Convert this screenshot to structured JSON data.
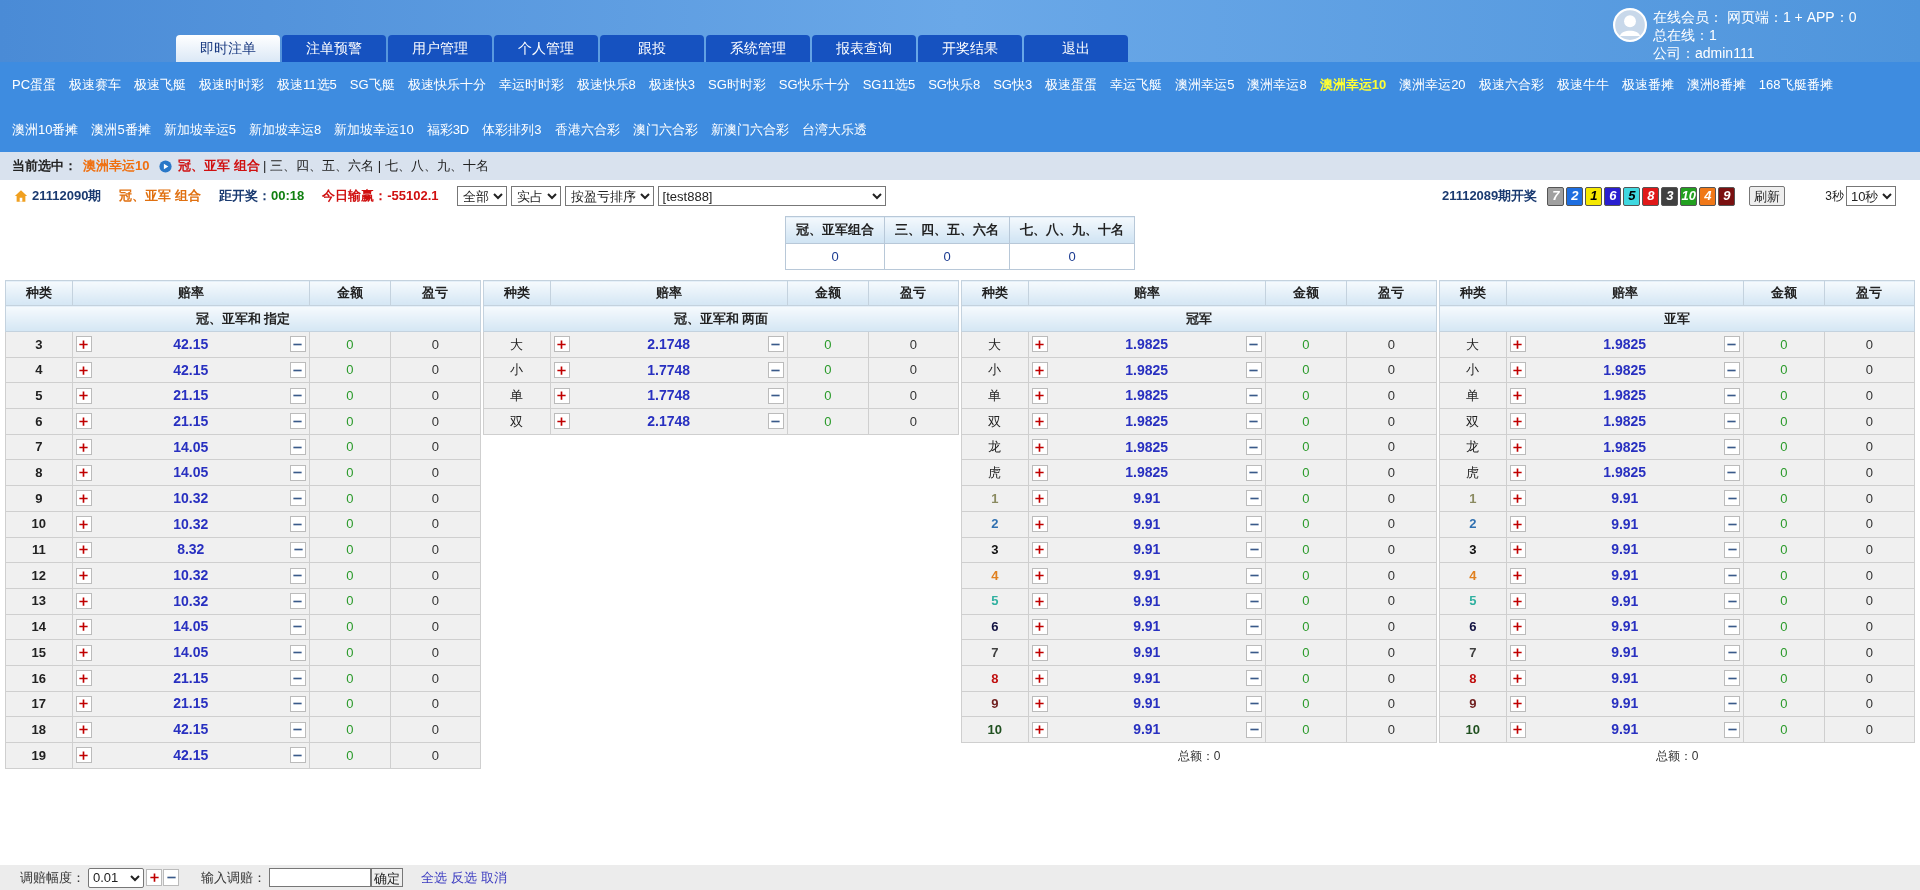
{
  "header": {
    "tabs": [
      {
        "label": "即时注单",
        "selected": true
      },
      {
        "label": "注单预警",
        "selected": false
      },
      {
        "label": "用户管理",
        "selected": false
      },
      {
        "label": "个人管理",
        "selected": false
      },
      {
        "label": "跟投",
        "selected": false
      },
      {
        "label": "系统管理",
        "selected": false
      },
      {
        "label": "报表查询",
        "selected": false
      },
      {
        "label": "开奖结果",
        "selected": false
      },
      {
        "label": "退出",
        "selected": false
      }
    ],
    "user_lines": [
      "在线会员： 网页端：1 + APP：0",
      "总在线：1",
      "公司：admin111"
    ]
  },
  "lottery_nav": [
    [
      {
        "label": "PC蛋蛋",
        "selected": false
      },
      {
        "label": "极速赛车",
        "selected": false
      },
      {
        "label": "极速飞艇",
        "selected": false
      },
      {
        "label": "极速时时彩",
        "selected": false
      },
      {
        "label": "极速11选5",
        "selected": false
      },
      {
        "label": "SG飞艇",
        "selected": false
      },
      {
        "label": "极速快乐十分",
        "selected": false
      },
      {
        "label": "幸运时时彩",
        "selected": false
      },
      {
        "label": "极速快乐8",
        "selected": false
      },
      {
        "label": "极速快3",
        "selected": false
      },
      {
        "label": "SG时时彩",
        "selected": false
      },
      {
        "label": "SG快乐十分",
        "selected": false
      },
      {
        "label": "SG11选5",
        "selected": false
      },
      {
        "label": "SG快乐8",
        "selected": false
      },
      {
        "label": "SG快3",
        "selected": false
      },
      {
        "label": "极速蛋蛋",
        "selected": false
      },
      {
        "label": "幸运飞艇",
        "selected": false
      },
      {
        "label": "澳洲幸运5",
        "selected": false
      },
      {
        "label": "澳洲幸运8",
        "selected": false
      },
      {
        "label": "澳洲幸运10",
        "selected": true
      },
      {
        "label": "澳洲幸运20",
        "selected": false
      },
      {
        "label": "极速六合彩",
        "selected": false
      },
      {
        "label": "极速牛牛",
        "selected": false
      },
      {
        "label": "极速番摊",
        "selected": false
      },
      {
        "label": "澳洲8番摊",
        "selected": false
      },
      {
        "label": "168飞艇番摊",
        "selected": false
      }
    ],
    [
      {
        "label": "澳洲10番摊",
        "selected": false
      },
      {
        "label": "澳洲5番摊",
        "selected": false
      },
      {
        "label": "新加坡幸运5",
        "selected": false
      },
      {
        "label": "新加坡幸运8",
        "selected": false
      },
      {
        "label": "新加坡幸运10",
        "selected": false
      },
      {
        "label": "福彩3D",
        "selected": false
      },
      {
        "label": "体彩排列3",
        "selected": false
      },
      {
        "label": "香港六合彩",
        "selected": false
      },
      {
        "label": "澳门六合彩",
        "selected": false
      },
      {
        "label": "新澳门六合彩",
        "selected": false
      },
      {
        "label": "台湾大乐透",
        "selected": false
      }
    ]
  ],
  "breadcrumb": {
    "label": "当前选中：",
    "lottery": "澳洲幸运10",
    "current": "冠、亚军 组合",
    "others": "| 三、四、五、六名 | 七、八、九、十名"
  },
  "info_bar": {
    "period": "21112090期",
    "play": "冠、亚军 组合",
    "countdown_label": "距开奖：",
    "countdown": "00:18",
    "profit_label": "今日输赢：",
    "profit": "-55102.1",
    "filters": [
      "全部",
      "实占",
      "按盈亏排序",
      "[test888]"
    ],
    "last_draw": "21112089期开奖",
    "balls": [
      {
        "number": "7",
        "color": "#a0a0a0"
      },
      {
        "number": "2",
        "color": "#1e6ee0"
      },
      {
        "number": "1",
        "color": "#f5e800"
      },
      {
        "number": "6",
        "color": "#2a1fd0"
      },
      {
        "number": "5",
        "color": "#3fd8e0"
      },
      {
        "number": "8",
        "color": "#e01818"
      },
      {
        "number": "3",
        "color": "#404040"
      },
      {
        "number": "10",
        "color": "#22a020"
      },
      {
        "number": "4",
        "color": "#f07818"
      },
      {
        "number": "9",
        "color": "#7a1010"
      }
    ],
    "refresh": "刷新",
    "interval_label": "3秒",
    "interval": "10秒"
  },
  "summary_table": {
    "columns": [
      "冠、亚军组合",
      "三、四、五、六名",
      "七、八、九、十名"
    ],
    "values": [
      "0",
      "0",
      "0"
    ]
  },
  "odds_tables": [
    {
      "columns": [
        "种类",
        "赔率",
        "金额",
        "盈亏"
      ],
      "title": "冠、亚军和 指定",
      "rows": [
        {
          "item": "3",
          "odds": "42.15",
          "amount": "0",
          "profit": "0"
        },
        {
          "item": "4",
          "odds": "42.15",
          "amount": "0",
          "profit": "0"
        },
        {
          "item": "5",
          "odds": "21.15",
          "amount": "0",
          "profit": "0"
        },
        {
          "item": "6",
          "odds": "21.15",
          "amount": "0",
          "profit": "0"
        },
        {
          "item": "7",
          "odds": "14.05",
          "amount": "0",
          "profit": "0"
        },
        {
          "item": "8",
          "odds": "14.05",
          "amount": "0",
          "profit": "0"
        },
        {
          "item": "9",
          "odds": "10.32",
          "amount": "0",
          "profit": "0"
        },
        {
          "item": "10",
          "odds": "10.32",
          "amount": "0",
          "profit": "0"
        },
        {
          "item": "11",
          "odds": "8.32",
          "amount": "0",
          "profit": "0"
        },
        {
          "item": "12",
          "odds": "10.32",
          "amount": "0",
          "profit": "0"
        },
        {
          "item": "13",
          "odds": "10.32",
          "amount": "0",
          "profit": "0"
        },
        {
          "item": "14",
          "odds": "14.05",
          "amount": "0",
          "profit": "0"
        },
        {
          "item": "15",
          "odds": "14.05",
          "amount": "0",
          "profit": "0"
        },
        {
          "item": "16",
          "odds": "21.15",
          "amount": "0",
          "profit": "0"
        },
        {
          "item": "17",
          "odds": "21.15",
          "amount": "0",
          "profit": "0"
        },
        {
          "item": "18",
          "odds": "42.15",
          "amount": "0",
          "profit": "0"
        },
        {
          "item": "19",
          "odds": "42.15",
          "amount": "0",
          "profit": "0"
        }
      ]
    },
    {
      "columns": [
        "种类",
        "赔率",
        "金额",
        "盈亏"
      ],
      "title": "冠、亚军和 两面",
      "rows": [
        {
          "item": "大",
          "odds": "2.1748",
          "amount": "0",
          "profit": "0"
        },
        {
          "item": "小",
          "odds": "1.7748",
          "amount": "0",
          "profit": "0"
        },
        {
          "item": "单",
          "odds": "1.7748",
          "amount": "0",
          "profit": "0"
        },
        {
          "item": "双",
          "odds": "2.1748",
          "amount": "0",
          "profit": "0"
        }
      ]
    },
    {
      "columns": [
        "种类",
        "赔率",
        "金额",
        "盈亏"
      ],
      "title": "冠军",
      "total": "总额：0",
      "rows": [
        {
          "item": "大",
          "odds": "1.9825",
          "amount": "0",
          "profit": "0"
        },
        {
          "item": "小",
          "odds": "1.9825",
          "amount": "0",
          "profit": "0"
        },
        {
          "item": "单",
          "odds": "1.9825",
          "amount": "0",
          "profit": "0"
        },
        {
          "item": "双",
          "odds": "1.9825",
          "amount": "0",
          "profit": "0"
        },
        {
          "item": "龙",
          "odds": "1.9825",
          "amount": "0",
          "profit": "0"
        },
        {
          "item": "虎",
          "odds": "1.9825",
          "amount": "0",
          "profit": "0"
        },
        {
          "item": "1",
          "color": "#8a8a60",
          "odds": "9.91",
          "amount": "0",
          "profit": "0"
        },
        {
          "item": "2",
          "color": "#3070b0",
          "odds": "9.91",
          "amount": "0",
          "profit": "0"
        },
        {
          "item": "3",
          "color": "#111111",
          "odds": "9.91",
          "amount": "0",
          "profit": "0"
        },
        {
          "item": "4",
          "color": "#e08020",
          "odds": "9.91",
          "amount": "0",
          "profit": "0"
        },
        {
          "item": "5",
          "color": "#30b0a0",
          "odds": "9.91",
          "amount": "0",
          "profit": "0"
        },
        {
          "item": "6",
          "color": "#101040",
          "odds": "9.91",
          "amount": "0",
          "profit": "0"
        },
        {
          "item": "7",
          "color": "#404040",
          "odds": "9.91",
          "amount": "0",
          "profit": "0"
        },
        {
          "item": "8",
          "color": "#c01010",
          "odds": "9.91",
          "amount": "0",
          "profit": "0"
        },
        {
          "item": "9",
          "color": "#702020",
          "odds": "9.91",
          "amount": "0",
          "profit": "0"
        },
        {
          "item": "10",
          "color": "#205020",
          "odds": "9.91",
          "amount": "0",
          "profit": "0"
        }
      ]
    },
    {
      "columns": [
        "种类",
        "赔率",
        "金额",
        "盈亏"
      ],
      "title": "亚军",
      "total": "总额：0",
      "rows": [
        {
          "item": "大",
          "odds": "1.9825",
          "amount": "0",
          "profit": "0"
        },
        {
          "item": "小",
          "odds": "1.9825",
          "amount": "0",
          "profit": "0"
        },
        {
          "item": "单",
          "odds": "1.9825",
          "amount": "0",
          "profit": "0"
        },
        {
          "item": "双",
          "odds": "1.9825",
          "amount": "0",
          "profit": "0"
        },
        {
          "item": "龙",
          "odds": "1.9825",
          "amount": "0",
          "profit": "0"
        },
        {
          "item": "虎",
          "odds": "1.9825",
          "amount": "0",
          "profit": "0"
        },
        {
          "item": "1",
          "color": "#8a8a60",
          "odds": "9.91",
          "amount": "0",
          "profit": "0"
        },
        {
          "item": "2",
          "color": "#3070b0",
          "odds": "9.91",
          "amount": "0",
          "profit": "0"
        },
        {
          "item": "3",
          "color": "#111111",
          "odds": "9.91",
          "amount": "0",
          "profit": "0"
        },
        {
          "item": "4",
          "color": "#e08020",
          "odds": "9.91",
          "amount": "0",
          "profit": "0"
        },
        {
          "item": "5",
          "color": "#30b0a0",
          "odds": "9.91",
          "amount": "0",
          "profit": "0"
        },
        {
          "item": "6",
          "color": "#101040",
          "odds": "9.91",
          "amount": "0",
          "profit": "0"
        },
        {
          "item": "7",
          "color": "#404040",
          "odds": "9.91",
          "amount": "0",
          "profit": "0"
        },
        {
          "item": "8",
          "color": "#c01010",
          "odds": "9.91",
          "amount": "0",
          "profit": "0"
        },
        {
          "item": "9",
          "color": "#702020",
          "odds": "9.91",
          "amount": "0",
          "profit": "0"
        },
        {
          "item": "10",
          "color": "#205020",
          "odds": "9.91",
          "amount": "0",
          "profit": "0"
        }
      ]
    }
  ],
  "footer": {
    "step_label": "调赔幅度：",
    "step": "0.01",
    "input_label": "输入调赔：",
    "confirm": "确定",
    "links": [
      "全选",
      "反选",
      "取消"
    ]
  }
}
